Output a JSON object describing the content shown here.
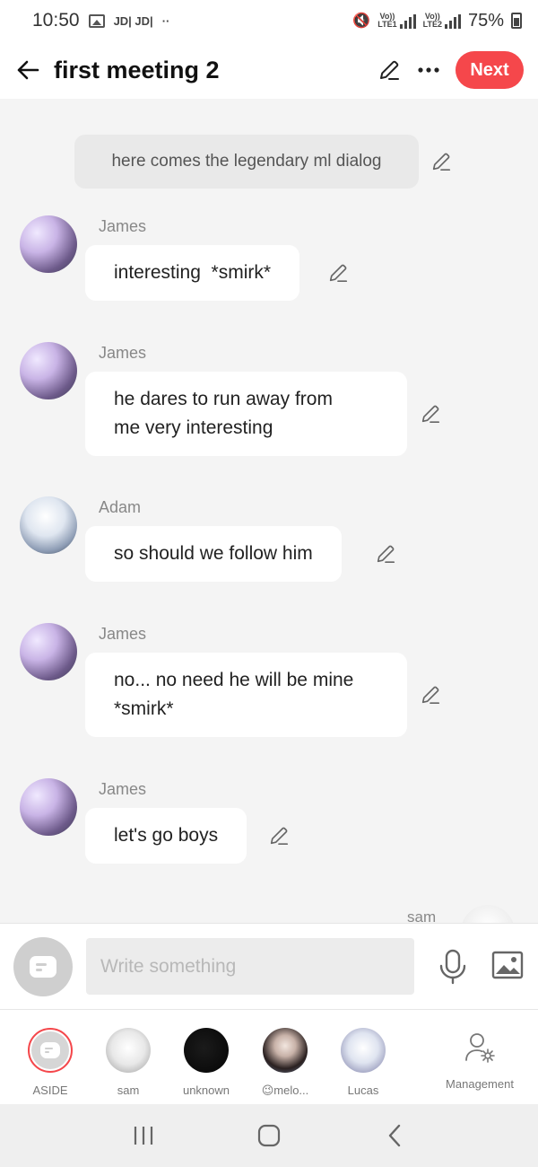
{
  "status_bar": {
    "time": "10:50",
    "carrier_labels": "JD| JD|",
    "dots": "··",
    "sim1": "LTE1",
    "sim2": "LTE2",
    "volte": "Vo))",
    "battery": "75%"
  },
  "header": {
    "title": "first meeting 2",
    "next_label": "Next",
    "accent_color": "#f5474b"
  },
  "narration": {
    "text": "here comes the legendary ml dialog"
  },
  "messages": [
    {
      "sender": "James",
      "lines": [
        "interesting  *smirk*"
      ]
    },
    {
      "sender": "James",
      "lines": [
        "he dares to run away from",
        "me very interesting"
      ]
    },
    {
      "sender": "Adam",
      "lines": [
        "so should we follow him"
      ]
    },
    {
      "sender": "James",
      "lines": [
        "no... no need he will be mine",
        "*smirk*"
      ]
    },
    {
      "sender": "James",
      "lines": [
        "let's go boys"
      ]
    },
    {
      "sender": "sam",
      "lines": []
    }
  ],
  "input": {
    "placeholder": "Write something",
    "value": ""
  },
  "characters": [
    {
      "label": "ASIDE"
    },
    {
      "label": "sam"
    },
    {
      "label": "unknown"
    },
    {
      "label": "😉melo..."
    },
    {
      "label": "Lucas"
    },
    {
      "label": "Management"
    }
  ],
  "icons": {
    "back": "arrow-left-icon",
    "edit": "pencil-icon",
    "more": "more-dots-icon",
    "mic": "microphone-icon",
    "image": "image-icon",
    "management": "user-gear-icon"
  }
}
